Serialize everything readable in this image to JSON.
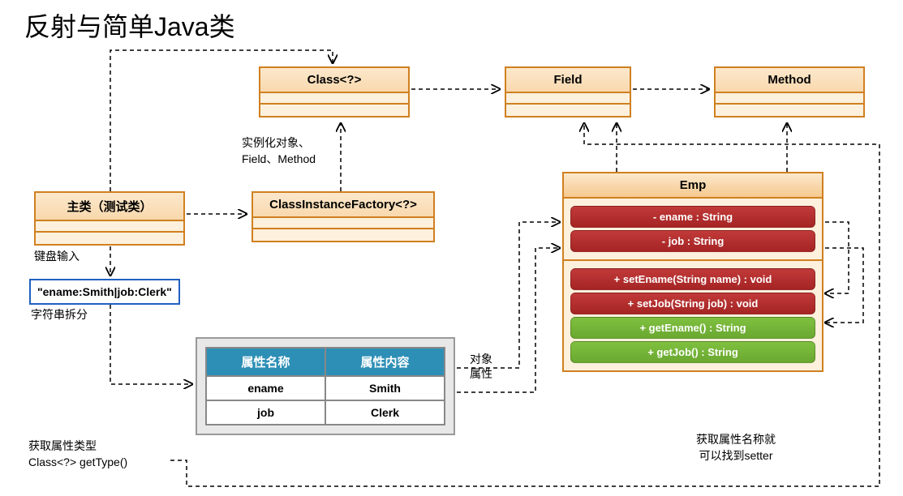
{
  "title": "反射与简单Java类",
  "boxes": {
    "class": "Class<?>",
    "field": "Field",
    "method": "Method",
    "main_class": "主类（测试类）",
    "factory": "ClassInstanceFactory<?>",
    "emp": "Emp"
  },
  "emp_members": {
    "fields": [
      "- ename : String",
      "- job : String"
    ],
    "setters": [
      "+ setEname(String name) : void",
      "+ setJob(String job) : void"
    ],
    "getters": [
      "+ getEname() : String",
      "+ getJob() : String"
    ]
  },
  "labels": {
    "instantiate": "实例化对象、\nField、Method",
    "keyboard_input": "键盘输入",
    "string_split": "字符串拆分",
    "object_attr": "对象\n属性",
    "get_attr_type": "获取属性类型\nClass<?> getType()",
    "find_setter": "获取属性名称就\n可以找到setter"
  },
  "input_string": "\"ename:Smith|job:Clerk\"",
  "table": {
    "headers": [
      "属性名称",
      "属性内容"
    ],
    "rows": [
      [
        "ename",
        "Smith"
      ],
      [
        "job",
        "Clerk"
      ]
    ]
  }
}
